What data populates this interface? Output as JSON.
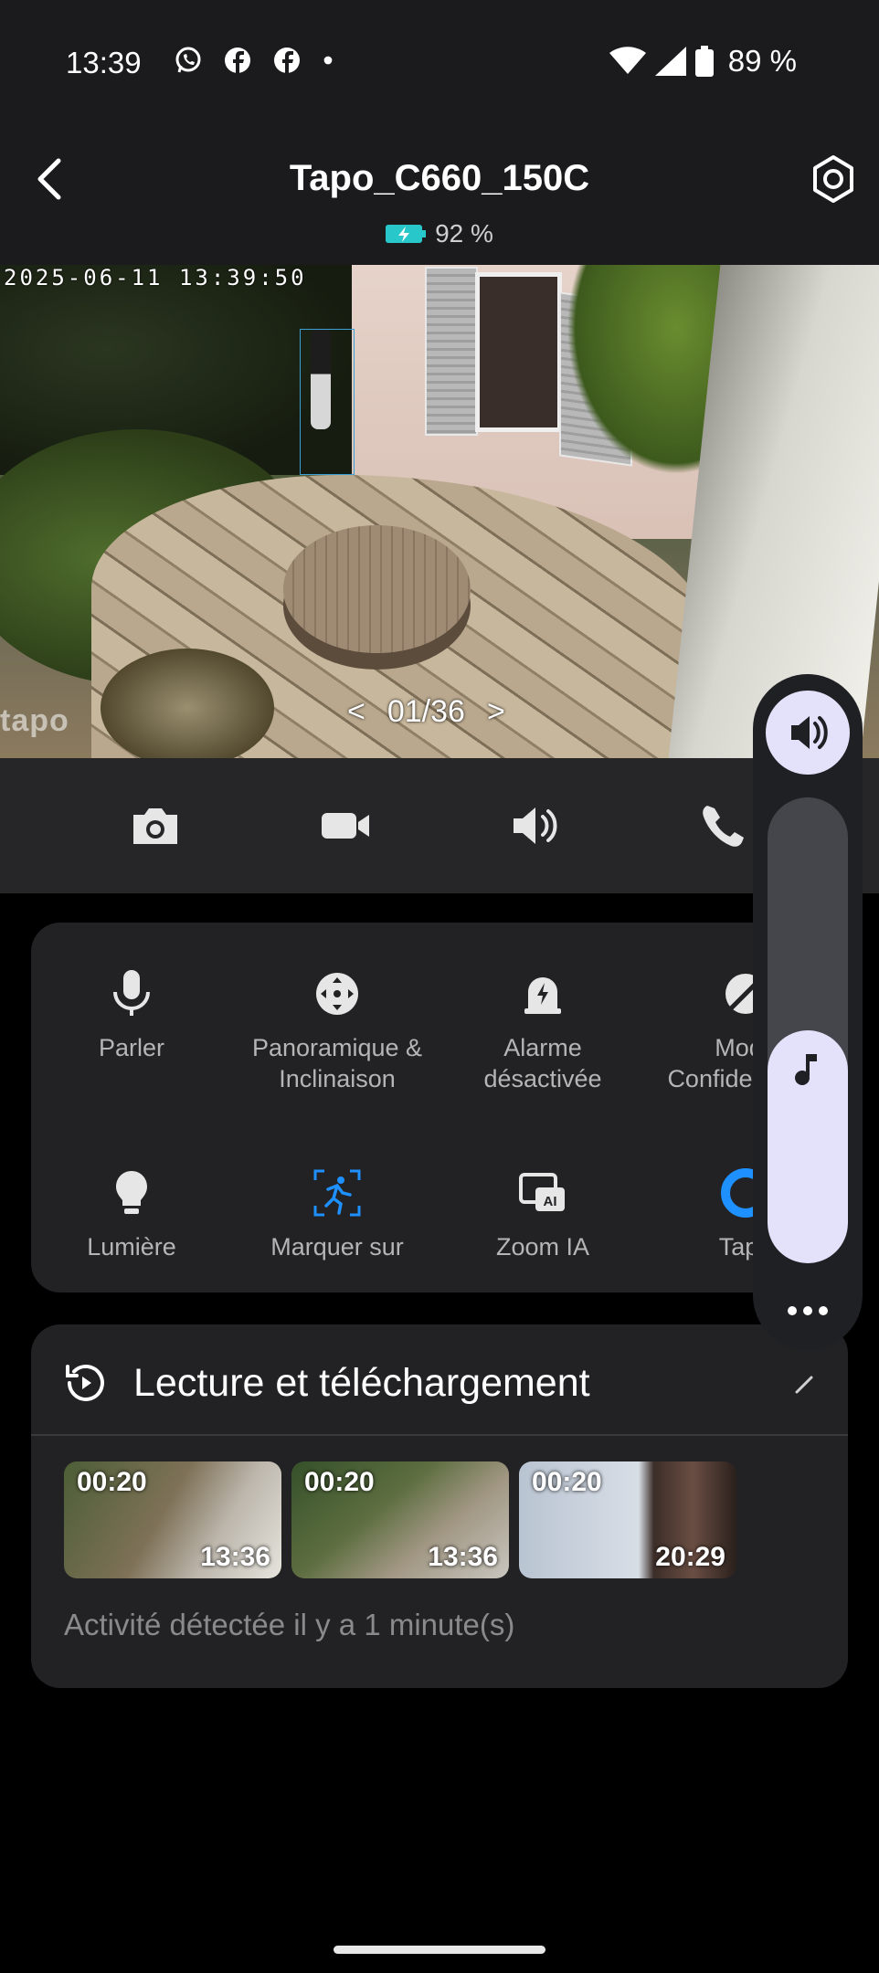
{
  "status_bar": {
    "time": "13:39",
    "battery_percent": "89 %"
  },
  "header": {
    "title": "Tapo_C660_150C",
    "device_battery": "92 %"
  },
  "video": {
    "timestamp": "2025-06-11 13:39:50",
    "watermark": "tapo",
    "pager": "01/36",
    "pager_prev": "<",
    "pager_next": ">"
  },
  "features_row1": [
    {
      "label": "Parler",
      "icon": "microphone-icon"
    },
    {
      "label": "Panoramique & Inclinaison",
      "icon": "pan-tilt-icon"
    },
    {
      "label": "Alarme désactivée",
      "icon": "alarm-icon"
    },
    {
      "label": "Mode Confidentialité",
      "icon": "privacy-icon"
    }
  ],
  "features_row2": [
    {
      "label": "Lumière",
      "icon": "light-bulb-icon"
    },
    {
      "label": "Marquer sur",
      "icon": "mark-person-icon"
    },
    {
      "label": "Zoom IA",
      "icon": "ai-zoom-icon"
    },
    {
      "label": "Tapo",
      "icon": "tapo-care-icon"
    }
  ],
  "playback": {
    "title": "Lecture et téléchargement",
    "clips": [
      {
        "duration": "00:20",
        "time": "13:36"
      },
      {
        "duration": "00:20",
        "time": "13:36"
      },
      {
        "duration": "00:20",
        "time": "20:29"
      }
    ],
    "activity": "Activité détectée il y a 1 minute(s)"
  },
  "volume": {
    "level_fraction": 0.5
  },
  "colors": {
    "accent": "#e4e2fb",
    "card_bg": "#222224",
    "blue_icon": "#1e90ff",
    "battery": "#28c7c9"
  }
}
